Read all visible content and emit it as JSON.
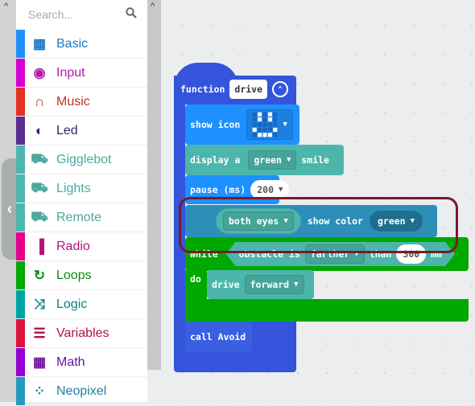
{
  "toolbox": {
    "search_placeholder": "Search...",
    "categories": [
      {
        "label": "Basic",
        "icon": "grid-icon",
        "color": "#1e90ff",
        "text": "#1e78c2"
      },
      {
        "label": "Input",
        "icon": "target-icon",
        "color": "#d400d4",
        "text": "#b019b0"
      },
      {
        "label": "Music",
        "icon": "headphones-icon",
        "color": "#e63022",
        "text": "#c23121"
      },
      {
        "label": "Led",
        "icon": "toggle-icon",
        "color": "#5c2d91",
        "text": "#3c2070"
      },
      {
        "label": "Gigglebot",
        "icon": "truck-icon",
        "color": "#4db6ac",
        "text": "#4aa89e"
      },
      {
        "label": "Lights",
        "icon": "truck-icon",
        "color": "#4db6ac",
        "text": "#4aa89e"
      },
      {
        "label": "Remote",
        "icon": "truck-icon",
        "color": "#4db6ac",
        "text": "#4aa89e"
      },
      {
        "label": "Radio",
        "icon": "signal-icon",
        "color": "#e3008c",
        "text": "#b3167a"
      },
      {
        "label": "Loops",
        "icon": "refresh-icon",
        "color": "#00aa00",
        "text": "#108a10"
      },
      {
        "label": "Logic",
        "icon": "shuffle-icon",
        "color": "#00a4a6",
        "text": "#107e88"
      },
      {
        "label": "Variables",
        "icon": "list-icon",
        "color": "#dc143c",
        "text": "#b0133a"
      },
      {
        "label": "Math",
        "icon": "calculator-icon",
        "color": "#9400d3",
        "text": "#6f10a0"
      },
      {
        "label": "Neopixel",
        "icon": "dots-circle-icon",
        "color": "#2699bf",
        "text": "#1f7fa0"
      }
    ]
  },
  "blocks": {
    "function": {
      "keyword": "function",
      "name": "drive",
      "color": "#3455db"
    },
    "show_icon": {
      "label": "show icon",
      "icon_pixels": [
        [
          0,
          1,
          0,
          1,
          0
        ],
        [
          0,
          1,
          0,
          1,
          0
        ],
        [
          0,
          0,
          0,
          0,
          0
        ],
        [
          1,
          0,
          0,
          0,
          1
        ],
        [
          0,
          1,
          1,
          1,
          0
        ]
      ],
      "color": "#1e90ff"
    },
    "display": {
      "label": "display a",
      "value": "green",
      "suffix": "smile",
      "color": "#4db6ac"
    },
    "pause": {
      "label": "pause (ms)",
      "value": "200",
      "color": "#1e90ff"
    },
    "eyes": {
      "which": "both eyes",
      "label": "show color",
      "color_value": "green",
      "color": "#2d8fb8"
    },
    "while": {
      "keyword": "while",
      "cond_label": "obstacle is",
      "cond_value": "farther",
      "than": "than",
      "distance": "300",
      "unit": "mm",
      "do": "do",
      "color": "#00a800"
    },
    "drive": {
      "label": "drive",
      "value": "forward",
      "color": "#4db6ac"
    },
    "call": {
      "label": "call Avoid",
      "color": "#3455db"
    }
  }
}
